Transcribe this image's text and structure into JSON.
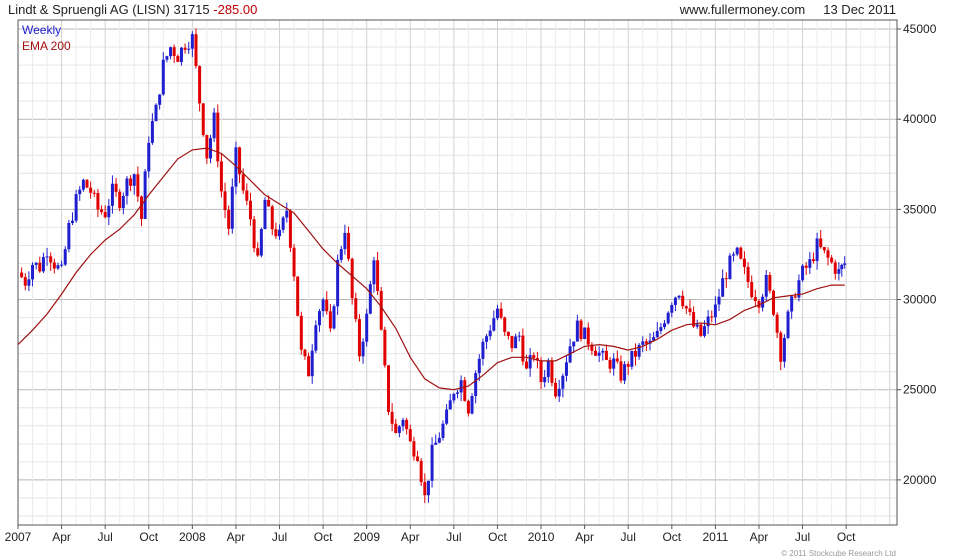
{
  "header": {
    "title": "Lindt & Spruengli AG (LISN)",
    "last": "31715",
    "change": "-285.00",
    "site": "www.fullermoney.com",
    "date": "13 Dec 2011"
  },
  "footer": {
    "credit": "© 2011 Stockcube Research Ltd"
  },
  "colors": {
    "up": "#1f1fd0",
    "down": "#e00000",
    "ema": "#a01010",
    "grid": "#cccccc",
    "axis": "#555555"
  },
  "chart_data": {
    "type": "candlestick",
    "title": "Lindt & Spruengli AG (LISN)",
    "xlabel": "",
    "ylabel": "",
    "x_tick_labels": [
      "2007",
      "Apr",
      "Jul",
      "Oct",
      "2008",
      "Apr",
      "Jul",
      "Oct",
      "2009",
      "Apr",
      "Jul",
      "Oct",
      "2010",
      "Apr",
      "Jul",
      "Oct",
      "2011",
      "Apr",
      "Jul",
      "Oct"
    ],
    "y_tick_labels": [
      "20000",
      "25000",
      "30000",
      "35000",
      "40000",
      "45000"
    ],
    "ylim": [
      17500,
      45500
    ],
    "x_range_months": [
      0,
      60.5
    ],
    "grid": true,
    "legend": {
      "position": "top-left",
      "entries": [
        "Weekly",
        "EMA 200"
      ]
    },
    "series": [
      {
        "name": "Weekly",
        "type": "close",
        "points": [
          [
            0.0,
            31500
          ],
          [
            0.5,
            31000
          ],
          [
            1.0,
            32000
          ],
          [
            1.5,
            31800
          ],
          [
            2.0,
            32800
          ],
          [
            2.5,
            32000
          ],
          [
            3.0,
            31500
          ],
          [
            3.5,
            34000
          ],
          [
            4.0,
            35500
          ],
          [
            4.5,
            36500
          ],
          [
            5.0,
            36000
          ],
          [
            5.5,
            35000
          ],
          [
            6.0,
            34800
          ],
          [
            6.5,
            36000
          ],
          [
            7.0,
            35500
          ],
          [
            7.5,
            36500
          ],
          [
            8.0,
            37000
          ],
          [
            8.5,
            34500
          ],
          [
            9.0,
            39000
          ],
          [
            9.5,
            40500
          ],
          [
            10.0,
            43000
          ],
          [
            10.5,
            44000
          ],
          [
            11.0,
            43500
          ],
          [
            11.5,
            44200
          ],
          [
            12.0,
            44500
          ],
          [
            12.5,
            41000
          ],
          [
            13.0,
            38000
          ],
          [
            13.5,
            40000
          ],
          [
            14.0,
            36000
          ],
          [
            14.5,
            34000
          ],
          [
            15.0,
            38000
          ],
          [
            15.5,
            36000
          ],
          [
            16.0,
            34500
          ],
          [
            16.5,
            32000
          ],
          [
            17.0,
            35500
          ],
          [
            17.5,
            34000
          ],
          [
            18.0,
            33500
          ],
          [
            18.5,
            35000
          ],
          [
            19.0,
            31500
          ],
          [
            19.5,
            27000
          ],
          [
            20.0,
            26000
          ],
          [
            20.5,
            29000
          ],
          [
            21.0,
            30000
          ],
          [
            21.5,
            28000
          ],
          [
            22.0,
            32000
          ],
          [
            22.5,
            34000
          ],
          [
            23.0,
            30000
          ],
          [
            23.5,
            27000
          ],
          [
            24.0,
            29000
          ],
          [
            24.5,
            32500
          ],
          [
            25.0,
            28000
          ],
          [
            25.5,
            24000
          ],
          [
            26.0,
            22500
          ],
          [
            26.5,
            23500
          ],
          [
            27.0,
            22000
          ],
          [
            27.5,
            21500
          ],
          [
            28.0,
            19000
          ],
          [
            28.5,
            21500
          ],
          [
            29.0,
            22500
          ],
          [
            29.5,
            23500
          ],
          [
            30.0,
            25000
          ],
          [
            30.5,
            25500
          ],
          [
            31.0,
            24000
          ],
          [
            31.5,
            26000
          ],
          [
            32.0,
            27500
          ],
          [
            32.5,
            28500
          ],
          [
            33.0,
            29500
          ],
          [
            33.5,
            28000
          ],
          [
            34.0,
            27500
          ],
          [
            34.5,
            28000
          ],
          [
            35.0,
            26000
          ],
          [
            35.5,
            27000
          ],
          [
            36.0,
            25500
          ],
          [
            36.5,
            26500
          ],
          [
            37.0,
            25000
          ],
          [
            37.5,
            26000
          ],
          [
            38.0,
            27500
          ],
          [
            38.5,
            28500
          ],
          [
            39.0,
            28000
          ],
          [
            39.5,
            27500
          ],
          [
            40.0,
            27000
          ],
          [
            40.5,
            26500
          ],
          [
            41.0,
            26500
          ],
          [
            41.5,
            25800
          ],
          [
            42.0,
            26500
          ],
          [
            42.5,
            27000
          ],
          [
            43.0,
            27500
          ],
          [
            43.5,
            27500
          ],
          [
            44.0,
            28000
          ],
          [
            44.5,
            29000
          ],
          [
            45.0,
            30000
          ],
          [
            45.5,
            30500
          ],
          [
            46.0,
            29500
          ],
          [
            46.5,
            28500
          ],
          [
            47.0,
            28000
          ],
          [
            47.5,
            28800
          ],
          [
            48.0,
            29500
          ],
          [
            48.5,
            31000
          ],
          [
            49.0,
            32000
          ],
          [
            49.5,
            32500
          ],
          [
            50.0,
            31500
          ],
          [
            50.5,
            30500
          ],
          [
            51.0,
            30000
          ],
          [
            51.5,
            31000
          ],
          [
            52.0,
            29500
          ],
          [
            52.5,
            27000
          ],
          [
            53.0,
            29000
          ],
          [
            53.5,
            30500
          ],
          [
            54.0,
            31500
          ],
          [
            54.5,
            32000
          ],
          [
            55.0,
            33000
          ],
          [
            55.5,
            32500
          ],
          [
            56.0,
            32000
          ],
          [
            56.5,
            31500
          ],
          [
            56.9,
            32000
          ]
        ]
      },
      {
        "name": "EMA 200",
        "type": "line",
        "points": [
          [
            0.0,
            27500
          ],
          [
            1.0,
            28300
          ],
          [
            2.0,
            29200
          ],
          [
            3.0,
            30300
          ],
          [
            4.0,
            31500
          ],
          [
            5.0,
            32500
          ],
          [
            6.0,
            33300
          ],
          [
            7.0,
            33900
          ],
          [
            8.0,
            34700
          ],
          [
            9.0,
            35800
          ],
          [
            10.0,
            36800
          ],
          [
            11.0,
            37800
          ],
          [
            12.0,
            38300
          ],
          [
            13.0,
            38400
          ],
          [
            14.0,
            38100
          ],
          [
            15.0,
            37400
          ],
          [
            16.0,
            36600
          ],
          [
            17.0,
            35800
          ],
          [
            18.0,
            35300
          ],
          [
            19.0,
            34800
          ],
          [
            20.0,
            33800
          ],
          [
            21.0,
            32800
          ],
          [
            22.0,
            32000
          ],
          [
            23.0,
            31300
          ],
          [
            24.0,
            30600
          ],
          [
            25.0,
            29600
          ],
          [
            26.0,
            28400
          ],
          [
            27.0,
            26800
          ],
          [
            28.0,
            25600
          ],
          [
            29.0,
            25100
          ],
          [
            30.0,
            25000
          ],
          [
            31.0,
            25200
          ],
          [
            32.0,
            25800
          ],
          [
            33.0,
            26500
          ],
          [
            34.0,
            26800
          ],
          [
            35.0,
            26800
          ],
          [
            36.0,
            26600
          ],
          [
            37.0,
            26600
          ],
          [
            38.0,
            27000
          ],
          [
            39.0,
            27400
          ],
          [
            40.0,
            27500
          ],
          [
            41.0,
            27400
          ],
          [
            42.0,
            27200
          ],
          [
            43.0,
            27400
          ],
          [
            44.0,
            27800
          ],
          [
            45.0,
            28300
          ],
          [
            46.0,
            28600
          ],
          [
            47.0,
            28700
          ],
          [
            48.0,
            28600
          ],
          [
            49.0,
            28900
          ],
          [
            50.0,
            29400
          ],
          [
            51.0,
            29700
          ],
          [
            52.0,
            30100
          ],
          [
            53.0,
            30200
          ],
          [
            54.0,
            30300
          ],
          [
            55.0,
            30600
          ],
          [
            56.0,
            30800
          ],
          [
            56.9,
            30800
          ]
        ]
      }
    ]
  }
}
